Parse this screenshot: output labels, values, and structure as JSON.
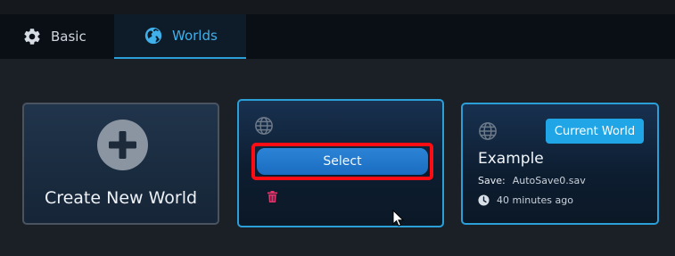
{
  "tabs": [
    {
      "label": "Basic",
      "icon": "gear-icon",
      "active": false
    },
    {
      "label": "Worlds",
      "icon": "globe-icon",
      "active": true
    }
  ],
  "create_card": {
    "label": "Create New World",
    "icon": "plus-circle-icon"
  },
  "world_card": {
    "select_label": "Select",
    "icon": "globe-icon",
    "delete_icon": "trash-icon"
  },
  "current_world": {
    "badge": "Current World",
    "name": "Example",
    "save_label": "Save:",
    "save_file": "AutoSave0.sav",
    "time_ago": "40 minutes ago"
  },
  "colors": {
    "accent": "#2a9fd8",
    "highlight": "#ff0d13",
    "button": "#1f75c9",
    "badge": "#20a6e6",
    "trash": "#e0356b"
  }
}
